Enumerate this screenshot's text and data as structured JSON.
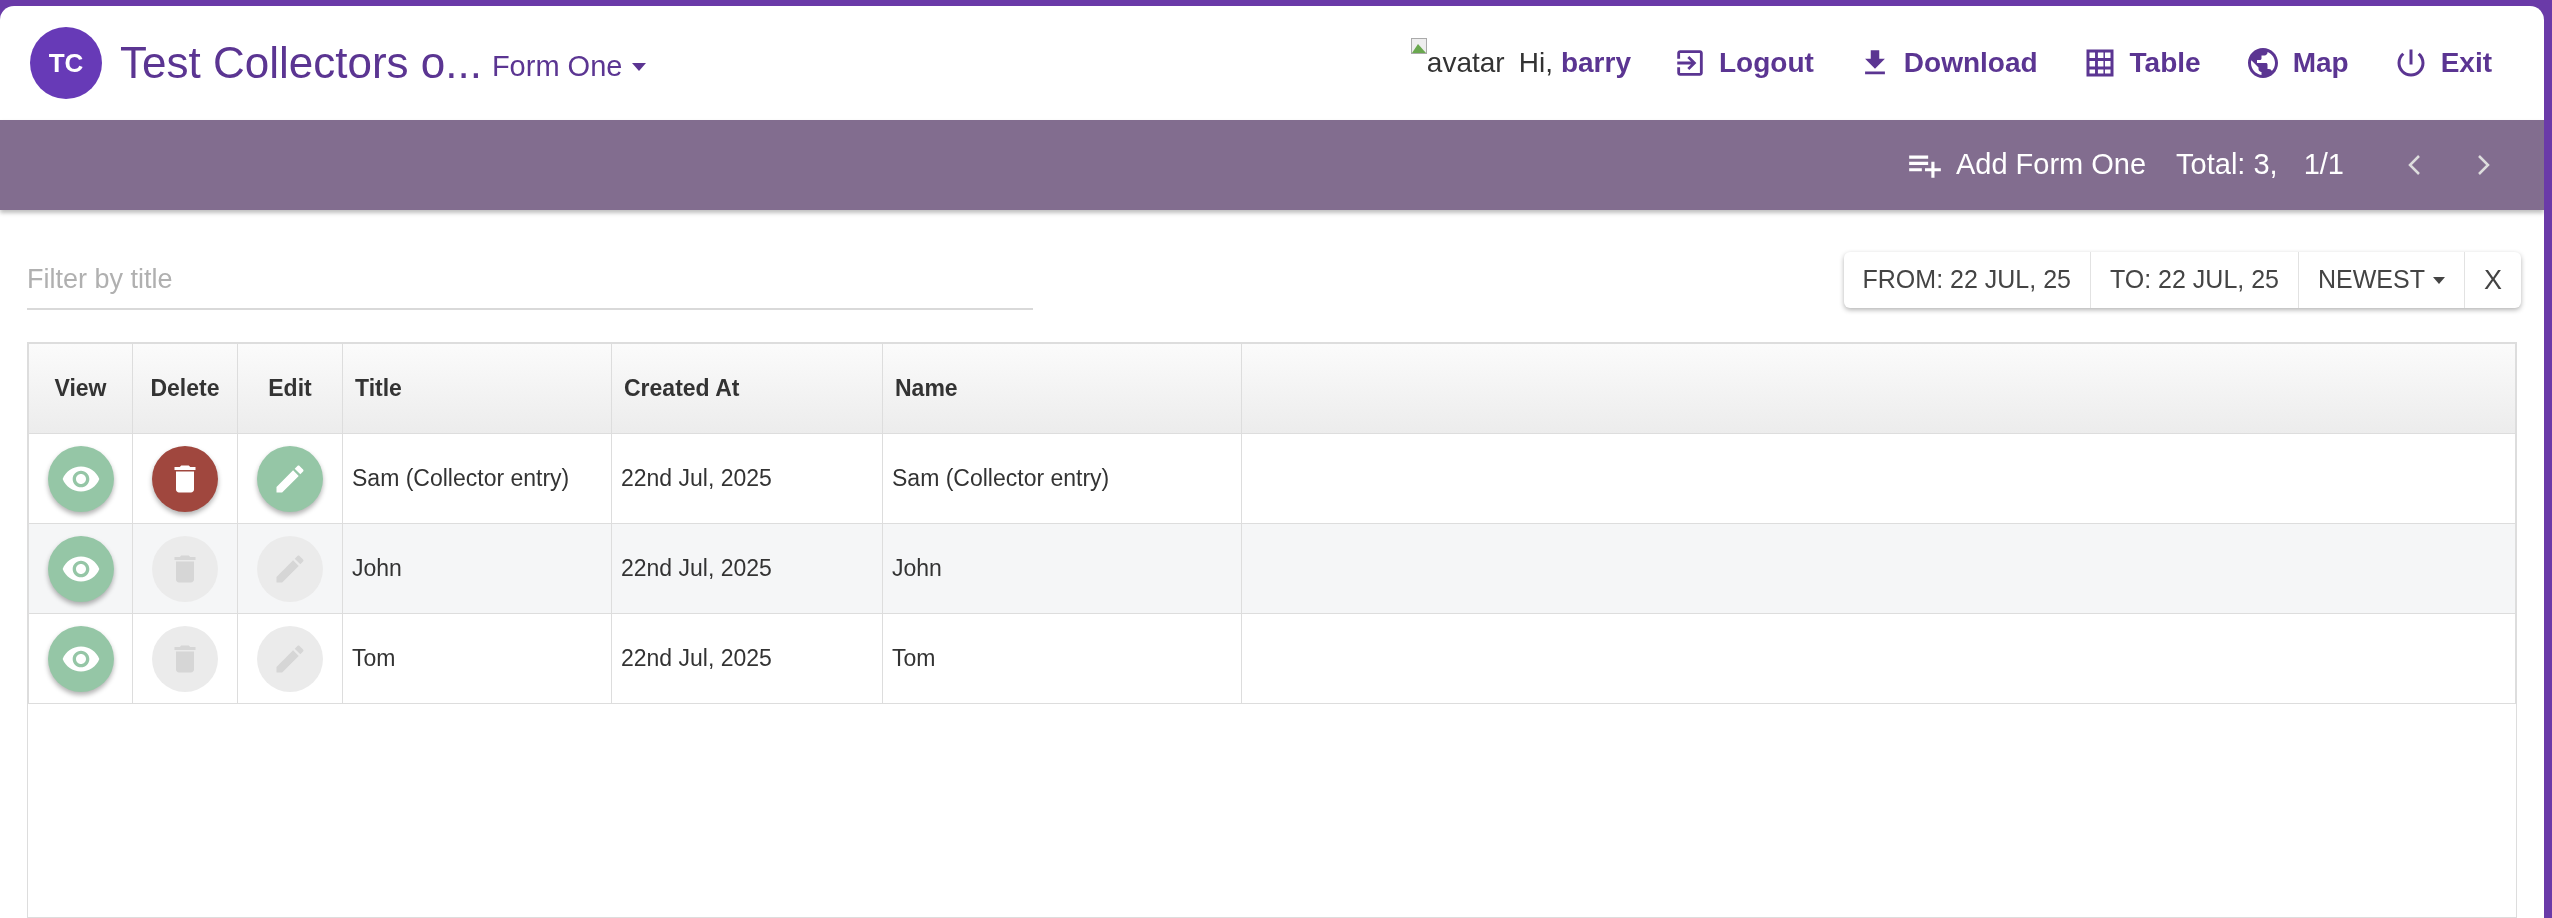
{
  "header": {
    "logo": "TC",
    "title": "Test Collectors o...",
    "form_menu": "Form One",
    "avatar_alt": "avatar",
    "greeting": "Hi,",
    "user": "barry",
    "nav": [
      {
        "kind": "logout",
        "label": "Logout"
      },
      {
        "kind": "download",
        "label": "Download"
      },
      {
        "kind": "table",
        "label": "Table"
      },
      {
        "kind": "map",
        "label": "Map"
      },
      {
        "kind": "exit",
        "label": "Exit"
      }
    ]
  },
  "toolbar": {
    "add_label": "Add Form One",
    "total": "Total: 3,",
    "page": "1/1"
  },
  "filter": {
    "placeholder": "Filter by title"
  },
  "date_controls": {
    "from": "FROM: 22 JUL, 25",
    "to": "TO: 22 JUL, 25",
    "sort": "NEWEST",
    "clear": "X"
  },
  "table": {
    "columns": [
      "View",
      "Delete",
      "Edit",
      "Title",
      "Created At",
      "Name"
    ],
    "rows": [
      {
        "title": "Sam (Collector entry)",
        "created_at": "22nd Jul, 2025",
        "name": "Sam (Collector entry)",
        "delete_disabled": false,
        "edit_disabled": false
      },
      {
        "title": "John",
        "created_at": "22nd Jul, 2025",
        "name": "John",
        "delete_disabled": true,
        "edit_disabled": true
      },
      {
        "title": "Tom",
        "created_at": "22nd Jul, 2025",
        "name": "Tom",
        "delete_disabled": true,
        "edit_disabled": true
      }
    ]
  }
}
